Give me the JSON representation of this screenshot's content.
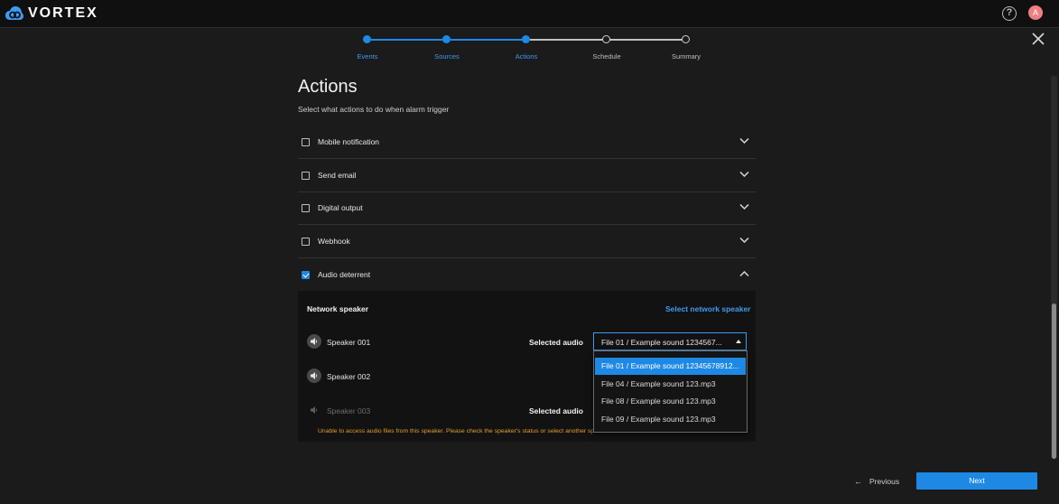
{
  "app": {
    "name": "VORTEX",
    "user_initial": "A",
    "accent_color": "#1e88e5",
    "warning_color": "#e0a030"
  },
  "stepper": {
    "steps": [
      {
        "label": "Events",
        "state": "done"
      },
      {
        "label": "Sources",
        "state": "done"
      },
      {
        "label": "Actions",
        "state": "current"
      },
      {
        "label": "Schedule",
        "state": "todo"
      },
      {
        "label": "Summary",
        "state": "todo"
      }
    ]
  },
  "page": {
    "title": "Actions",
    "subtitle": "Select what actions to do when alarm trigger"
  },
  "actions": [
    {
      "label": "Mobile notification",
      "checked": false,
      "expanded": false
    },
    {
      "label": "Send email",
      "checked": false,
      "expanded": false
    },
    {
      "label": "Digital output",
      "checked": false,
      "expanded": false
    },
    {
      "label": "Webhook",
      "checked": false,
      "expanded": false
    },
    {
      "label": "Audio deterrent",
      "checked": true,
      "expanded": true
    }
  ],
  "audio_deterrent": {
    "section_title": "Network speaker",
    "select_link": "Select network speaker",
    "selected_audio_label": "Selected audio",
    "speakers": [
      {
        "name": "Speaker 001",
        "enabled": true,
        "selected_audio": "File 01 /  Example sound 1234567..."
      },
      {
        "name": "Speaker 002",
        "enabled": true
      },
      {
        "name": "Speaker 003",
        "enabled": false
      }
    ],
    "warning": "Unable to access audio files from this speaker. Please check the speaker's status or select another speaker to continue.",
    "dropdown_options": [
      {
        "label": "File 01 /  Example sound 12345678912...",
        "highlighted": true
      },
      {
        "label": "File 04 /  Example sound 123.mp3",
        "highlighted": false
      },
      {
        "label": "File 08 /  Example sound 123.mp3",
        "highlighted": false
      },
      {
        "label": "File 09 /  Example sound 123.mp3",
        "highlighted": false
      }
    ]
  },
  "footer": {
    "previous_label": "Previous",
    "next_label": "Next"
  }
}
